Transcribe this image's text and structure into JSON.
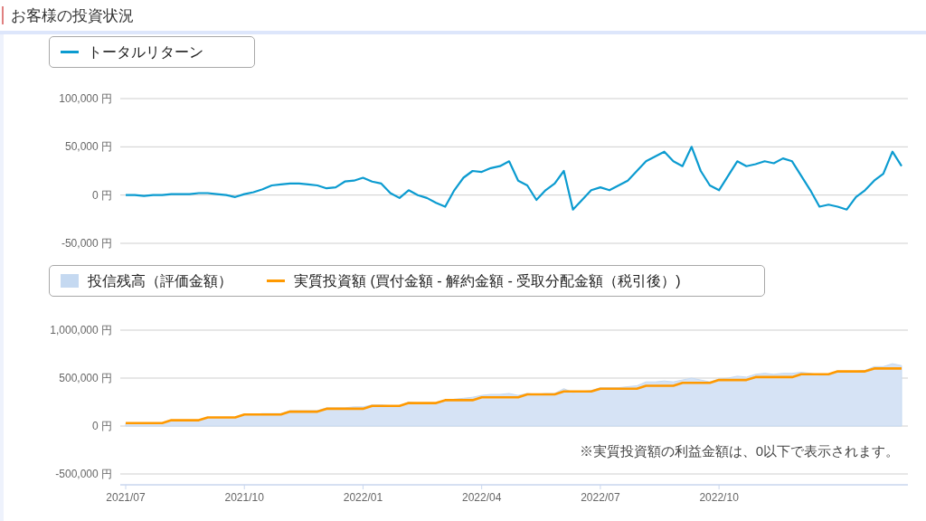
{
  "section_title": "お客様の投資状況",
  "charts": [
    {
      "chart_data": {
        "type": "line",
        "series": [
          {
            "name": "トータルリターン",
            "color": "#0b9bd0",
            "type": "line",
            "values": [
              0,
              0,
              -1000,
              0,
              0,
              1000,
              1000,
              1000,
              2000,
              2000,
              1000,
              0,
              -2000,
              1000,
              3000,
              6000,
              10000,
              11000,
              12000,
              12000,
              11000,
              10000,
              7000,
              8000,
              14000,
              15000,
              18000,
              14000,
              12000,
              2000,
              -3000,
              5000,
              0,
              -3000,
              -8000,
              -12000,
              5000,
              18000,
              25000,
              24000,
              28000,
              30000,
              35000,
              15000,
              10000,
              -5000,
              5000,
              12000,
              25000,
              -15000,
              -5000,
              5000,
              8000,
              5000,
              10000,
              15000,
              25000,
              35000,
              40000,
              45000,
              35000,
              30000,
              50000,
              25000,
              10000,
              5000,
              20000,
              35000,
              30000,
              32000,
              35000,
              33000,
              38000,
              35000,
              20000,
              5000,
              -12000,
              -10000,
              -12000,
              -15000,
              -2000,
              5000,
              15000,
              22000,
              45000,
              30000
            ]
          }
        ],
        "ylim": [
          -50000,
          100000
        ],
        "yticks": [
          {
            "value": -50000,
            "label": "-50,000 円"
          },
          {
            "value": 0,
            "label": "0 円"
          },
          {
            "value": 50000,
            "label": "50,000 円"
          },
          {
            "value": 100000,
            "label": "100,000 円"
          }
        ]
      }
    },
    {
      "chart_data": {
        "type": "area",
        "series": [
          {
            "name": "投信残高（評価金額）",
            "color": "#c5d9f1",
            "type": "area",
            "values": [
              30000,
              30000,
              30000,
              30000,
              30000,
              60000,
              60000,
              60000,
              60000,
              90000,
              90000,
              90000,
              90000,
              120000,
              120000,
              130000,
              130000,
              130000,
              160000,
              160000,
              160000,
              160000,
              190000,
              190000,
              190000,
              200000,
              200000,
              220000,
              220000,
              210000,
              210000,
              250000,
              240000,
              240000,
              230000,
              260000,
              280000,
              290000,
              300000,
              320000,
              330000,
              330000,
              340000,
              320000,
              340000,
              330000,
              340000,
              340000,
              390000,
              350000,
              360000,
              370000,
              400000,
              400000,
              400000,
              410000,
              420000,
              460000,
              460000,
              470000,
              460000,
              480000,
              500000,
              480000,
              460000,
              490000,
              500000,
              520000,
              510000,
              540000,
              550000,
              540000,
              550000,
              550000,
              560000,
              550000,
              530000,
              530000,
              560000,
              560000,
              570000,
              580000,
              620000,
              620000,
              650000,
              630000
            ]
          },
          {
            "name": "実質投資額 (買付金額 - 解約金額 - 受取分配金額（税引後）)",
            "color": "#ff9900",
            "type": "line",
            "values": [
              30000,
              30000,
              30000,
              30000,
              30000,
              60000,
              60000,
              60000,
              60000,
              90000,
              90000,
              90000,
              90000,
              120000,
              120000,
              120000,
              120000,
              120000,
              150000,
              150000,
              150000,
              150000,
              180000,
              180000,
              180000,
              180000,
              180000,
              210000,
              210000,
              210000,
              210000,
              240000,
              240000,
              240000,
              240000,
              270000,
              270000,
              270000,
              270000,
              300000,
              300000,
              300000,
              300000,
              300000,
              330000,
              330000,
              330000,
              330000,
              360000,
              360000,
              360000,
              360000,
              390000,
              390000,
              390000,
              390000,
              390000,
              420000,
              420000,
              420000,
              420000,
              450000,
              450000,
              450000,
              450000,
              480000,
              480000,
              480000,
              480000,
              510000,
              510000,
              510000,
              510000,
              510000,
              540000,
              540000,
              540000,
              540000,
              570000,
              570000,
              570000,
              570000,
              600000,
              600000,
              600000,
              600000
            ]
          }
        ],
        "ylim": [
          -500000,
          1000000
        ],
        "categories": [
          "2021/07",
          null,
          null,
          null,
          null,
          null,
          null,
          null,
          null,
          null,
          null,
          null,
          null,
          "2021/10",
          null,
          null,
          null,
          null,
          null,
          null,
          null,
          null,
          null,
          null,
          null,
          null,
          "2022/01",
          null,
          null,
          null,
          null,
          null,
          null,
          null,
          null,
          null,
          null,
          null,
          null,
          "2022/04",
          null,
          null,
          null,
          null,
          null,
          null,
          null,
          null,
          null,
          null,
          null,
          null,
          "2022/07",
          null,
          null,
          null,
          null,
          null,
          null,
          null,
          null,
          null,
          null,
          null,
          null,
          "2022/10",
          null,
          null,
          null,
          null,
          null,
          null,
          null,
          null,
          null,
          null,
          null,
          null,
          null,
          null,
          null,
          null,
          null,
          null,
          null,
          null
        ],
        "yticks": [
          {
            "value": -500000,
            "label": "-500,000 円"
          },
          {
            "value": 0,
            "label": "0 円"
          },
          {
            "value": 500000,
            "label": "500,000 円"
          },
          {
            "value": 1000000,
            "label": "1,000,000 円"
          }
        ],
        "annotations": [
          "※実質投資額の利益金額は、0以下で表示されます。"
        ]
      }
    }
  ]
}
